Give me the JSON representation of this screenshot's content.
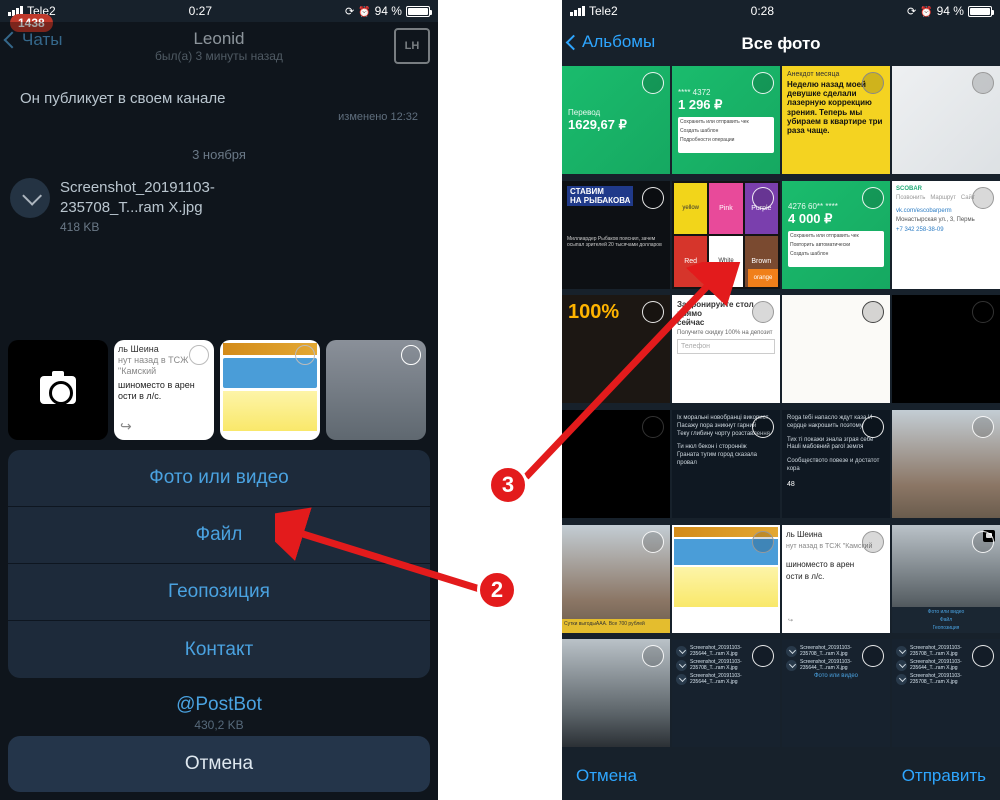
{
  "status": {
    "carrier": "Tele2",
    "time1": "0:27",
    "time2": "0:28",
    "battery": "94 %"
  },
  "left": {
    "badge": "1438",
    "back": "Чаты",
    "name": "Leonid",
    "subtitle": "был(а) 3 минуты назад",
    "message": "Он публикует в своем канале",
    "msg_edit": "изменено 12:32",
    "date": "3 ноября",
    "file_name1": "Screenshot_20191103-",
    "file_name2": "235708_T...ram X.jpg",
    "file_size": "418 KB",
    "thumb_text1": "ль Шеина",
    "thumb_text2": "нут назад в ТСЖ \"Камский",
    "thumb_text3": "шиноместо в арен",
    "thumb_text4": "ости в л/с.",
    "menu": {
      "photo": "Фото или видео",
      "file": "Файл",
      "geo": "Геопозиция",
      "contact": "Контакт",
      "postbot": "@PostBot",
      "size2": "430,2 KB"
    },
    "cancel": "Отмена"
  },
  "right": {
    "back": "Альбомы",
    "title": "Все фото",
    "yellow_head": "Анекдот месяца",
    "yellow_body": "Неделю назад моей девушке сделали лазерную коррекцию зрения. Теперь мы убираем в квартире три раза чаще.",
    "green_top_num": "1 296 ₽",
    "green_top_dots": "**** 4372",
    "green2_card": "4276 60** ****",
    "green2_amt": "4 000 ₽",
    "hundred": "100%",
    "form_h1": "Забронируйте стол прямо\nсейчас",
    "form_h2": "Получите скидку 100% на депозит",
    "form_ph": "Телефон",
    "shein1": "ль Шеина",
    "shein2": "нут назад в ТСЖ \"Камский",
    "shein3": "шиноместо в арен",
    "shein4": "ости в л/с.",
    "mini_file1": "Screenshot_20191103-\n235644_T...ram X.jpg",
    "mini_file2": "Screenshot_20191103-\n235708_T...ram X.jpg",
    "mini_menu1": "Фото или видео",
    "mini_menu2": "Файл",
    "mini_menu3": "Геопозиция",
    "list_save": "Сохранить или отправить чек",
    "list_tpl": "Создать шаблон",
    "list_det": "Подробности операции",
    "list_rep": "Повторить автоматически",
    "toolbar": {
      "cancel": "Отмена",
      "send": "Отправить"
    }
  },
  "anno": {
    "b2": "2",
    "b3": "3"
  }
}
